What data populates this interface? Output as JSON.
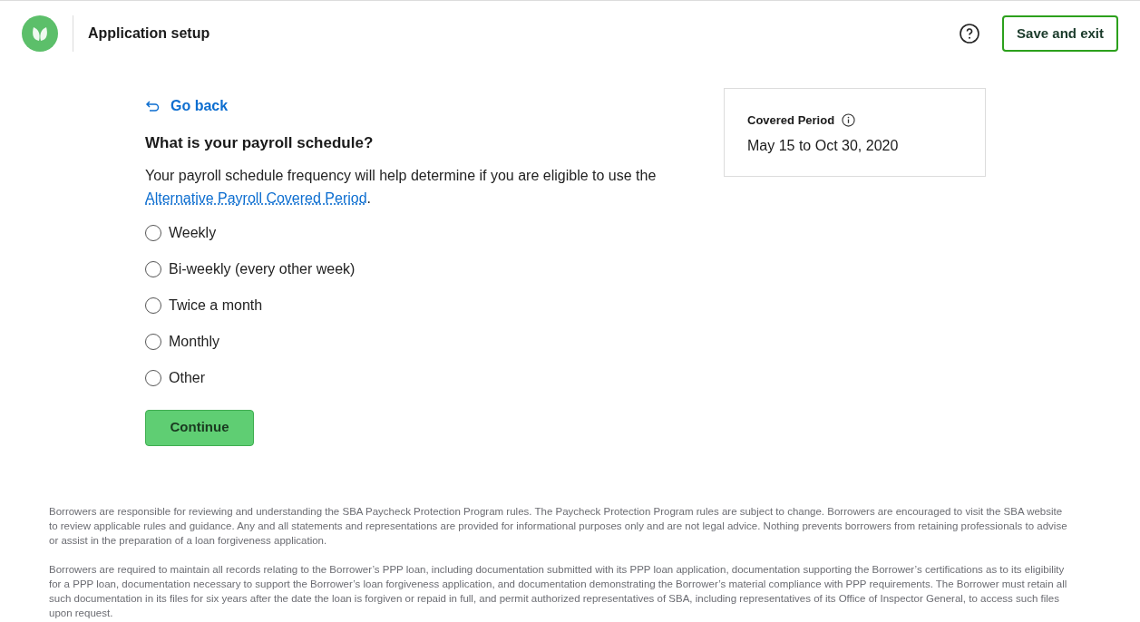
{
  "header": {
    "title": "Application setup",
    "save_button": "Save and exit"
  },
  "back_link": "Go back",
  "question": "What is your payroll schedule?",
  "description": {
    "text": "Your payroll schedule frequency will help determine if you are eligible to use the ",
    "link": "Alternative Payroll Covered Period",
    "end": "."
  },
  "options": [
    {
      "label": "Weekly",
      "selected": false
    },
    {
      "label": "Bi-weekly (every other week)",
      "selected": false
    },
    {
      "label": "Twice a month",
      "selected": false
    },
    {
      "label": "Monthly",
      "selected": false
    },
    {
      "label": "Other",
      "selected": false
    }
  ],
  "continue_button": "Continue",
  "covered_period": {
    "label": "Covered Period",
    "value": "May 15 to Oct 30, 2020"
  },
  "disclaimers": [
    "Borrowers are responsible for reviewing and understanding the SBA Paycheck Protection Program rules. The Paycheck Protection Program rules are subject to change. Borrowers are encouraged to visit the SBA website to review applicable rules and guidance. Any and all statements and representations are provided for informational purposes only and are not legal advice. Nothing prevents borrowers from retaining professionals to advise or assist in the preparation of a loan forgiveness application.",
    "Borrowers are required to maintain all records relating to the Borrower’s PPP loan, including documentation submitted with its PPP loan application, documentation supporting the Borrower’s certifications as to its eligibility for a PPP loan, documentation necessary to support the Borrower’s loan forgiveness application, and documentation demonstrating the Borrower’s material compliance with PPP requirements. The Borrower must retain all such documentation in its files for six years after the date the loan is forgiven or repaid in full, and permit authorized representatives of SBA, including representatives of its Office of Inspector General, to access such files upon request."
  ]
}
